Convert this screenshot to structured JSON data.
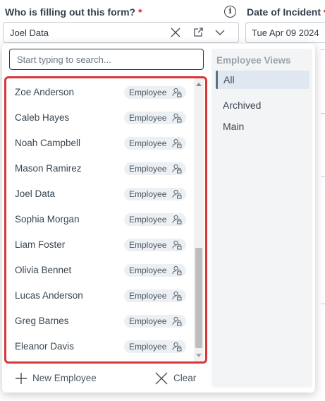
{
  "form": {
    "who_label": "Who is filling out this form?",
    "required_mark": "*",
    "selected_value": "Joel Data",
    "date_label": "Date of Incident",
    "date_value": "Tue Apr 09 2024"
  },
  "dropdown": {
    "search_placeholder": "Start typing to search...",
    "employees": [
      {
        "name": "Zoe Anderson",
        "badge": "Employee"
      },
      {
        "name": "Caleb Hayes",
        "badge": "Employee"
      },
      {
        "name": "Noah Campbell",
        "badge": "Employee"
      },
      {
        "name": "Mason Ramirez",
        "badge": "Employee"
      },
      {
        "name": "Joel Data",
        "badge": "Employee"
      },
      {
        "name": "Sophia Morgan",
        "badge": "Employee"
      },
      {
        "name": "Liam Foster",
        "badge": "Employee"
      },
      {
        "name": "Olivia Bennet",
        "badge": "Employee"
      },
      {
        "name": "Lucas Anderson",
        "badge": "Employee"
      },
      {
        "name": "Greg Barnes",
        "badge": "Employee"
      },
      {
        "name": "Eleanor Davis",
        "badge": "Employee"
      }
    ],
    "new_employee_label": "New Employee",
    "clear_label": "Clear"
  },
  "views": {
    "title": "Employee Views",
    "items": [
      {
        "label": "All",
        "active": true
      },
      {
        "label": "Archived",
        "active": false
      },
      {
        "label": "Main",
        "active": false
      }
    ]
  },
  "colors": {
    "highlight_border": "#d9363a",
    "required": "#d22b2b",
    "badge_bg": "#ecf0f3",
    "views_bg": "#f3f4f6",
    "active_view_bg": "#dfe7f1"
  },
  "icons": {
    "info": "info-icon",
    "clear": "close-icon",
    "open": "open-external-icon",
    "expand": "chevron-down-icon",
    "badge": "user-lock-icon",
    "add": "plus-icon"
  }
}
